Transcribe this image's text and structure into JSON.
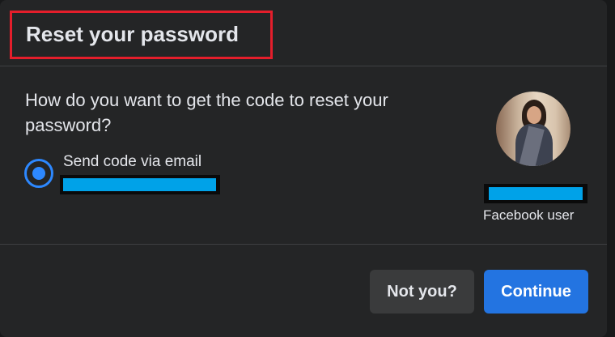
{
  "dialog": {
    "title": "Reset your password",
    "question": "How do you want to get the code to reset your password?",
    "option": {
      "label": "Send code via email",
      "selected": true
    },
    "user": {
      "label": "Facebook user"
    },
    "buttons": {
      "not_you": "Not you?",
      "continue": "Continue"
    }
  },
  "colors": {
    "background": "#242526",
    "accent": "#2374e1",
    "radio": "#2d88ff",
    "highlight_border": "#e41e2b",
    "redaction": "#00a2e8"
  }
}
